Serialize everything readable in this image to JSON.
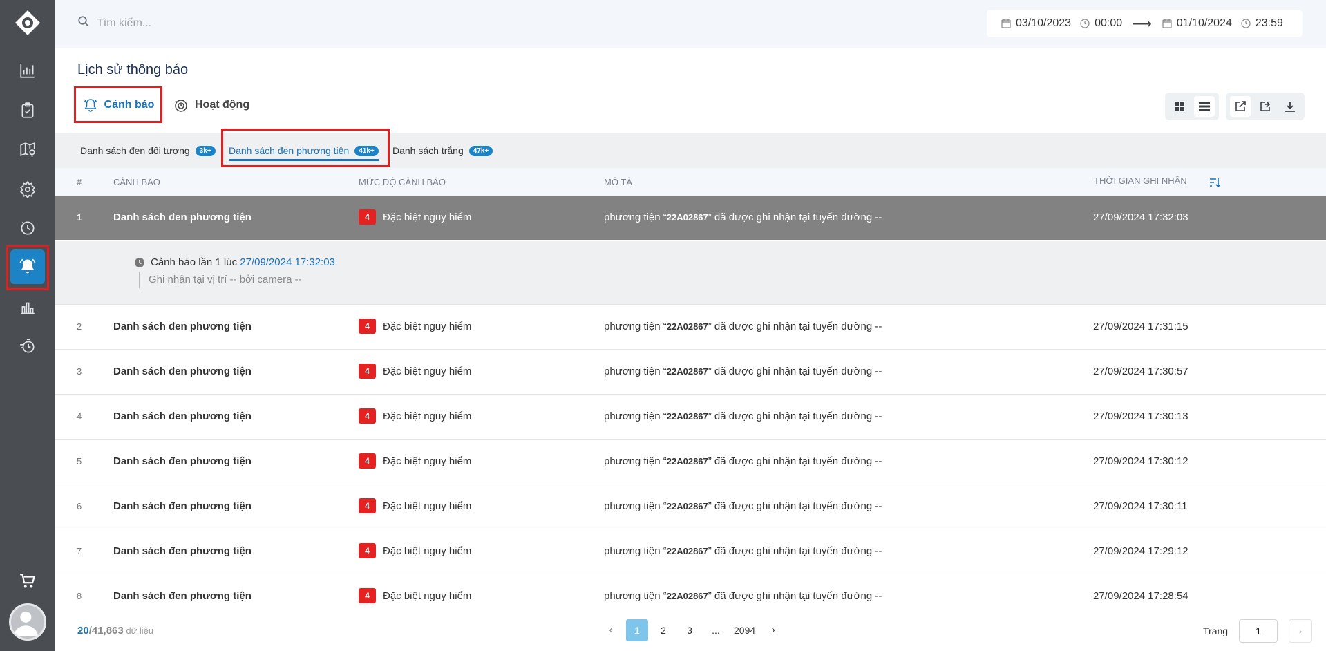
{
  "search": {
    "placeholder": "Tìm kiếm..."
  },
  "date_range": {
    "start_date": "03/10/2023",
    "start_time": "00:00",
    "end_date": "01/10/2024",
    "end_time": "23:59"
  },
  "page_title": "Lịch sử thông báo",
  "top_tabs": {
    "alert": "Cảnh báo",
    "activity": "Hoạt động"
  },
  "sub_tabs": [
    {
      "label": "Danh sách đen đối tượng",
      "badge": "3k+"
    },
    {
      "label": "Danh sách đen phương tiện",
      "badge": "41k+"
    },
    {
      "label": "Danh sách trắng",
      "badge": "47k+"
    }
  ],
  "columns": {
    "num": "#",
    "alert": "CẢNH BÁO",
    "level": "MỨC ĐỘ CẢNH BÁO",
    "desc": "MÔ TẢ",
    "time": "THỜI GIAN GHI NHẬN"
  },
  "rows": [
    {
      "num": "1",
      "name": "Danh sách đen phương tiện",
      "level_num": "4",
      "level": "Đặc biệt nguy hiểm",
      "desc_pre": "phương tiện “",
      "plate": "22A02867",
      "desc_post": "” đã được ghi nhận tại tuyến đường --",
      "time": "27/09/2024 17:32:03"
    },
    {
      "num": "2",
      "name": "Danh sách đen phương tiện",
      "level_num": "4",
      "level": "Đặc biệt nguy hiểm",
      "desc_pre": "phương tiện “",
      "plate": "22A02867",
      "desc_post": "” đã được ghi nhận tại tuyến đường --",
      "time": "27/09/2024 17:31:15"
    },
    {
      "num": "3",
      "name": "Danh sách đen phương tiện",
      "level_num": "4",
      "level": "Đặc biệt nguy hiểm",
      "desc_pre": "phương tiện “",
      "plate": "22A02867",
      "desc_post": "” đã được ghi nhận tại tuyến đường --",
      "time": "27/09/2024 17:30:57"
    },
    {
      "num": "4",
      "name": "Danh sách đen phương tiện",
      "level_num": "4",
      "level": "Đặc biệt nguy hiểm",
      "desc_pre": "phương tiện “",
      "plate": "22A02867",
      "desc_post": "” đã được ghi nhận tại tuyến đường --",
      "time": "27/09/2024 17:30:13"
    },
    {
      "num": "5",
      "name": "Danh sách đen phương tiện",
      "level_num": "4",
      "level": "Đặc biệt nguy hiểm",
      "desc_pre": "phương tiện “",
      "plate": "22A02867",
      "desc_post": "” đã được ghi nhận tại tuyến đường --",
      "time": "27/09/2024 17:30:12"
    },
    {
      "num": "6",
      "name": "Danh sách đen phương tiện",
      "level_num": "4",
      "level": "Đặc biệt nguy hiểm",
      "desc_pre": "phương tiện “",
      "plate": "22A02867",
      "desc_post": "” đã được ghi nhận tại tuyến đường --",
      "time": "27/09/2024 17:30:11"
    },
    {
      "num": "7",
      "name": "Danh sách đen phương tiện",
      "level_num": "4",
      "level": "Đặc biệt nguy hiểm",
      "desc_pre": "phương tiện “",
      "plate": "22A02867",
      "desc_post": "” đã được ghi nhận tại tuyến đường --",
      "time": "27/09/2024 17:29:12"
    },
    {
      "num": "8",
      "name": "Danh sách đen phương tiện",
      "level_num": "4",
      "level": "Đặc biệt nguy hiểm",
      "desc_pre": "phương tiện “",
      "plate": "22A02867",
      "desc_post": "” đã được ghi nhận tại tuyến đường --",
      "time": "27/09/2024 17:28:54"
    }
  ],
  "detail": {
    "line1_pre": "Cảnh báo lần 1 lúc ",
    "line1_time": "27/09/2024 17:32:03",
    "line2": "Ghi nhận tại vị trí -- bởi camera --"
  },
  "footer": {
    "current": "20",
    "total": "/41,863",
    "unit": " dữ liệu",
    "pages": [
      "1",
      "2",
      "3",
      "...",
      "2094"
    ],
    "page_label": "Trang",
    "page_value": "1"
  },
  "colors": {
    "accent": "#1d83c7",
    "danger": "#e52222",
    "sidebar": "#4a4d52",
    "selected_row": "#828282"
  }
}
